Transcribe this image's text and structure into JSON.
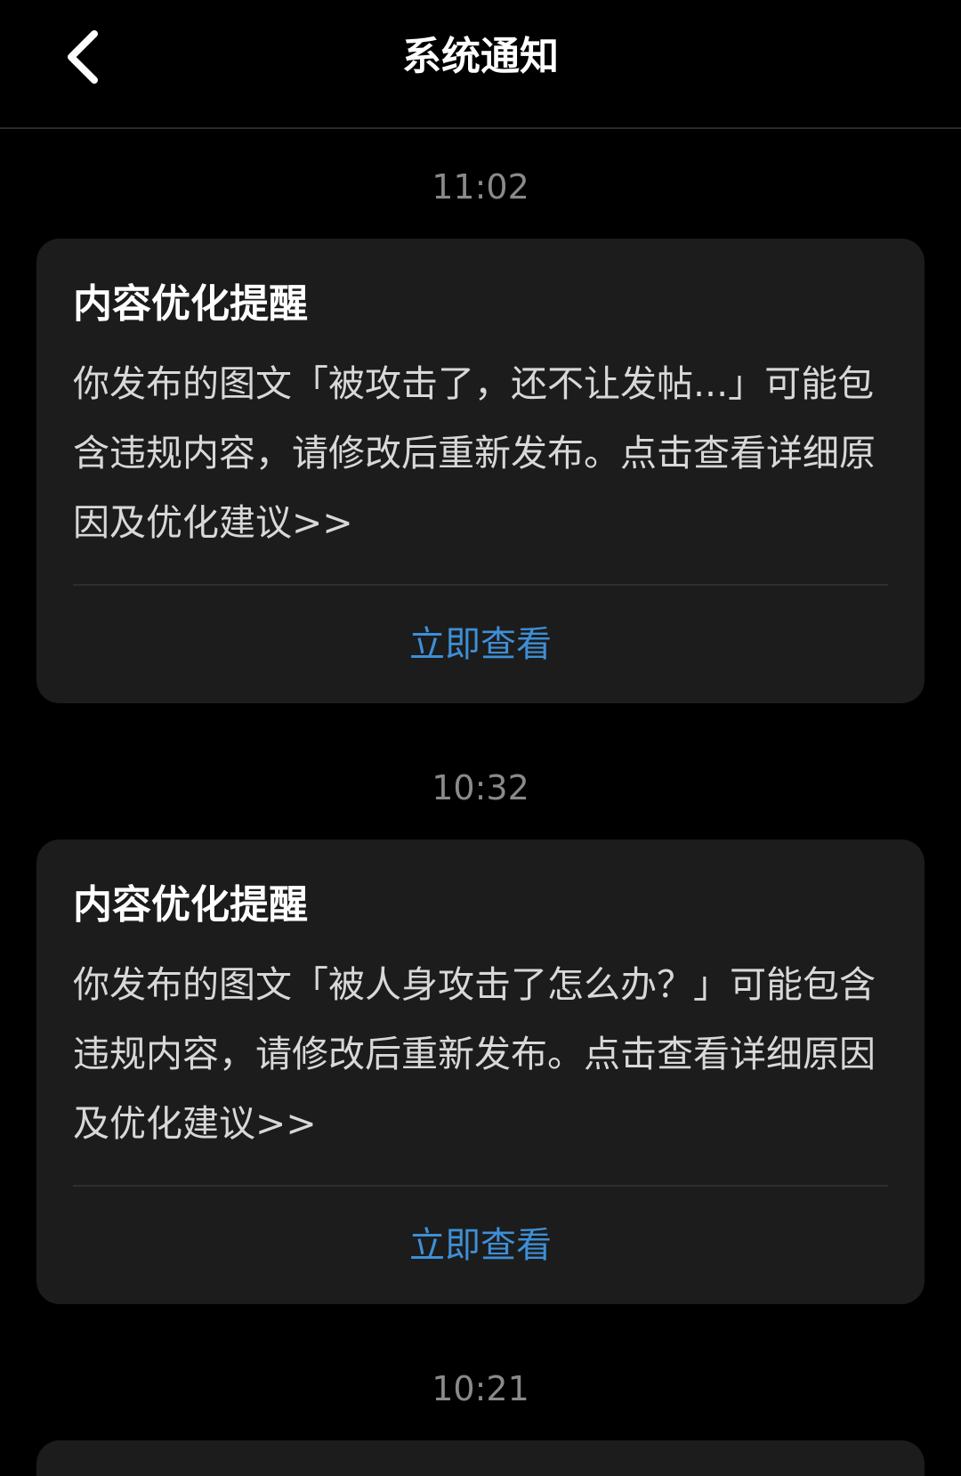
{
  "header": {
    "title": "系统通知",
    "back_icon": "chevron-left-icon"
  },
  "notifications": [
    {
      "time": "11:02",
      "title": "内容优化提醒",
      "body": "你发布的图文「被攻击了，还不让发帖...」可能包含违规内容，请修改后重新发布。点击查看详细原因及优化建议>>",
      "action_label": "立即查看"
    },
    {
      "time": "10:32",
      "title": "内容优化提醒",
      "body": "你发布的图文「被人身攻击了怎么办？」可能包含违规内容，请修改后重新发布。点击查看详细原因及优化建议>>",
      "action_label": "立即查看"
    },
    {
      "time": "10:21"
    }
  ],
  "colors": {
    "background": "#000000",
    "card": "#1c1c1c",
    "link": "#3e8fd6",
    "timestamp": "#8a8a8a"
  }
}
